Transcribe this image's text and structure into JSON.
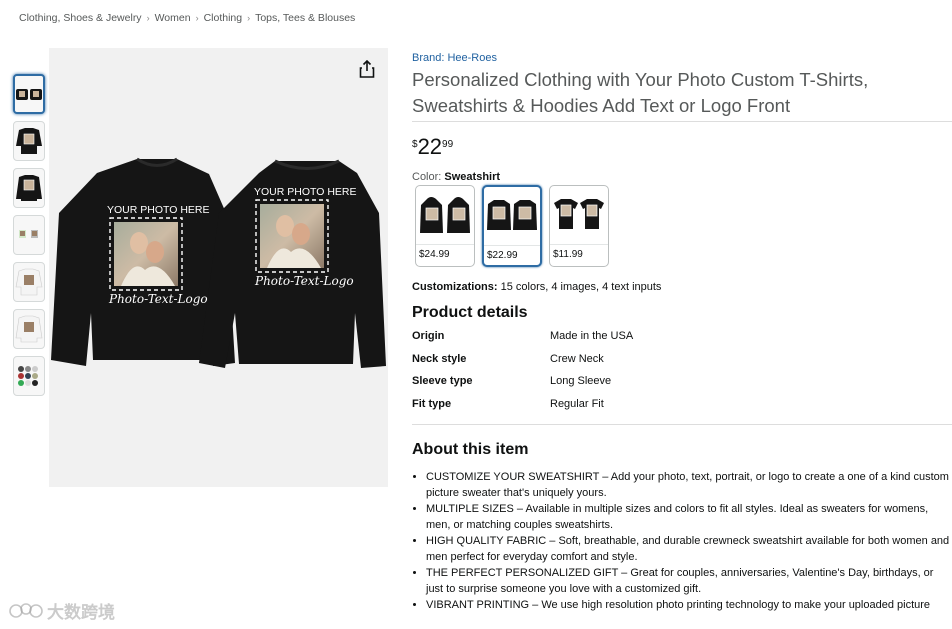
{
  "breadcrumb": [
    "Clothing, Shoes & Jewelry",
    "Women",
    "Clothing",
    "Tops, Tees & Blouses"
  ],
  "breadcrumb_separator": "›",
  "main_image": {
    "tag_left": "YOUR PHOTO HERE",
    "tag_right": "YOUR PHOTO HERE",
    "script_left": "Photo-Text-Logo",
    "script_right": "Photo-Text-Logo",
    "share_icon": "share-icon"
  },
  "product": {
    "brand": "Brand: Hee-Roes",
    "title": "Personalized Clothing with Your Photo Custom T-Shirts, Sweatshirts & Hoodies Add Text or Logo Front",
    "price_symbol": "$",
    "price_whole": "22",
    "price_fraction": "99"
  },
  "color": {
    "label": "Color:",
    "selected": "Sweatshirt",
    "options": [
      {
        "price": "$24.99"
      },
      {
        "price": "$22.99"
      },
      {
        "price": "$11.99"
      }
    ]
  },
  "customizations": {
    "label": "Customizations:",
    "value": "15 colors, 4 images, 4 text inputs"
  },
  "product_details": {
    "heading": "Product details",
    "rows": [
      {
        "key": "Origin",
        "value": "Made in the USA"
      },
      {
        "key": "Neck style",
        "value": "Crew Neck"
      },
      {
        "key": "Sleeve type",
        "value": "Long Sleeve"
      },
      {
        "key": "Fit type",
        "value": "Regular Fit"
      }
    ]
  },
  "about": {
    "heading": "About this item",
    "bullets": [
      "CUSTOMIZE YOUR SWEATSHIRT – Add your photo, text, portrait, or logo to create a one of a kind custom picture sweater that's uniquely yours.",
      "MULTIPLE SIZES – Available in multiple sizes and colors to fit all styles. Ideal as sweaters for womens, men, or matching couples sweatshirts.",
      "HIGH QUALITY FABRIC – Soft, breathable, and durable crewneck sweatshirt available for both women and men perfect for everyday comfort and style.",
      "THE PERFECT PERSONALIZED GIFT – Great for couples, anniversaries, Valentine's Day, birthdays, or just to surprise someone you love with a customized gift.",
      "VIBRANT PRINTING – We use high resolution photo printing technology to make your uploaded picture"
    ]
  },
  "watermark": "大数跨境",
  "colors": {
    "link": "#2162a1",
    "selected_border": "#2e6ca4",
    "shirt": "#151515"
  }
}
